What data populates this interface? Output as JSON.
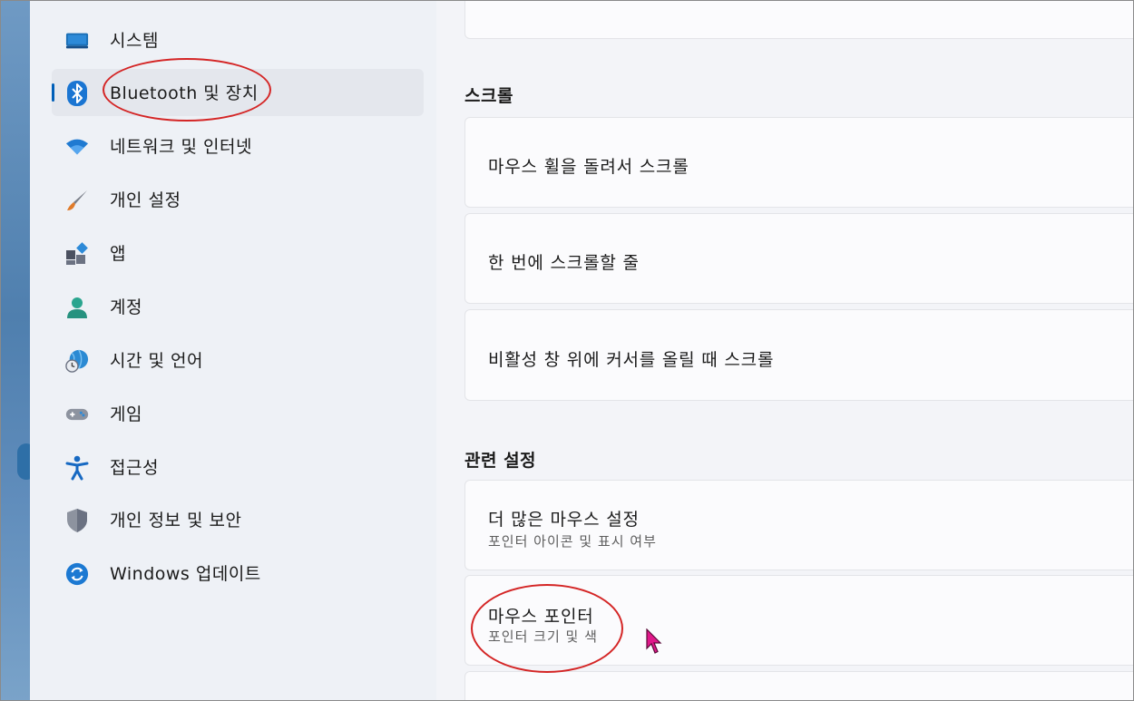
{
  "sidebar": {
    "items": [
      {
        "label": "시스템",
        "icon": "monitor-icon"
      },
      {
        "label": "Bluetooth 및 장치",
        "icon": "bluetooth-icon",
        "active": true
      },
      {
        "label": "네트워크 및 인터넷",
        "icon": "wifi-icon"
      },
      {
        "label": "개인 설정",
        "icon": "paintbrush-icon"
      },
      {
        "label": "앱",
        "icon": "apps-icon"
      },
      {
        "label": "계정",
        "icon": "person-icon"
      },
      {
        "label": "시간 및 언어",
        "icon": "globe-clock-icon"
      },
      {
        "label": "게임",
        "icon": "gamepad-icon"
      },
      {
        "label": "접근성",
        "icon": "accessibility-icon"
      },
      {
        "label": "개인 정보 및 보안",
        "icon": "shield-icon"
      },
      {
        "label": "Windows 업데이트",
        "icon": "update-icon"
      }
    ]
  },
  "main": {
    "scroll_section": {
      "header": "스크롤",
      "items": [
        {
          "title": "마우스 휠을 돌려서 스크롤"
        },
        {
          "title": "한 번에 스크롤할 줄"
        },
        {
          "title": "비활성 창 위에 커서를 올릴 때 스크롤"
        }
      ]
    },
    "related_section": {
      "header": "관련 설정",
      "items": [
        {
          "title": "더 많은 마우스 설정",
          "subtitle": "포인터 아이콘 및 표시 여부"
        },
        {
          "title": "마우스 포인터",
          "subtitle": "포인터 크기 및 색"
        }
      ]
    }
  },
  "colors": {
    "accent": "#005fb8",
    "annotation": "#d42525",
    "cursor": "#e0188a"
  }
}
